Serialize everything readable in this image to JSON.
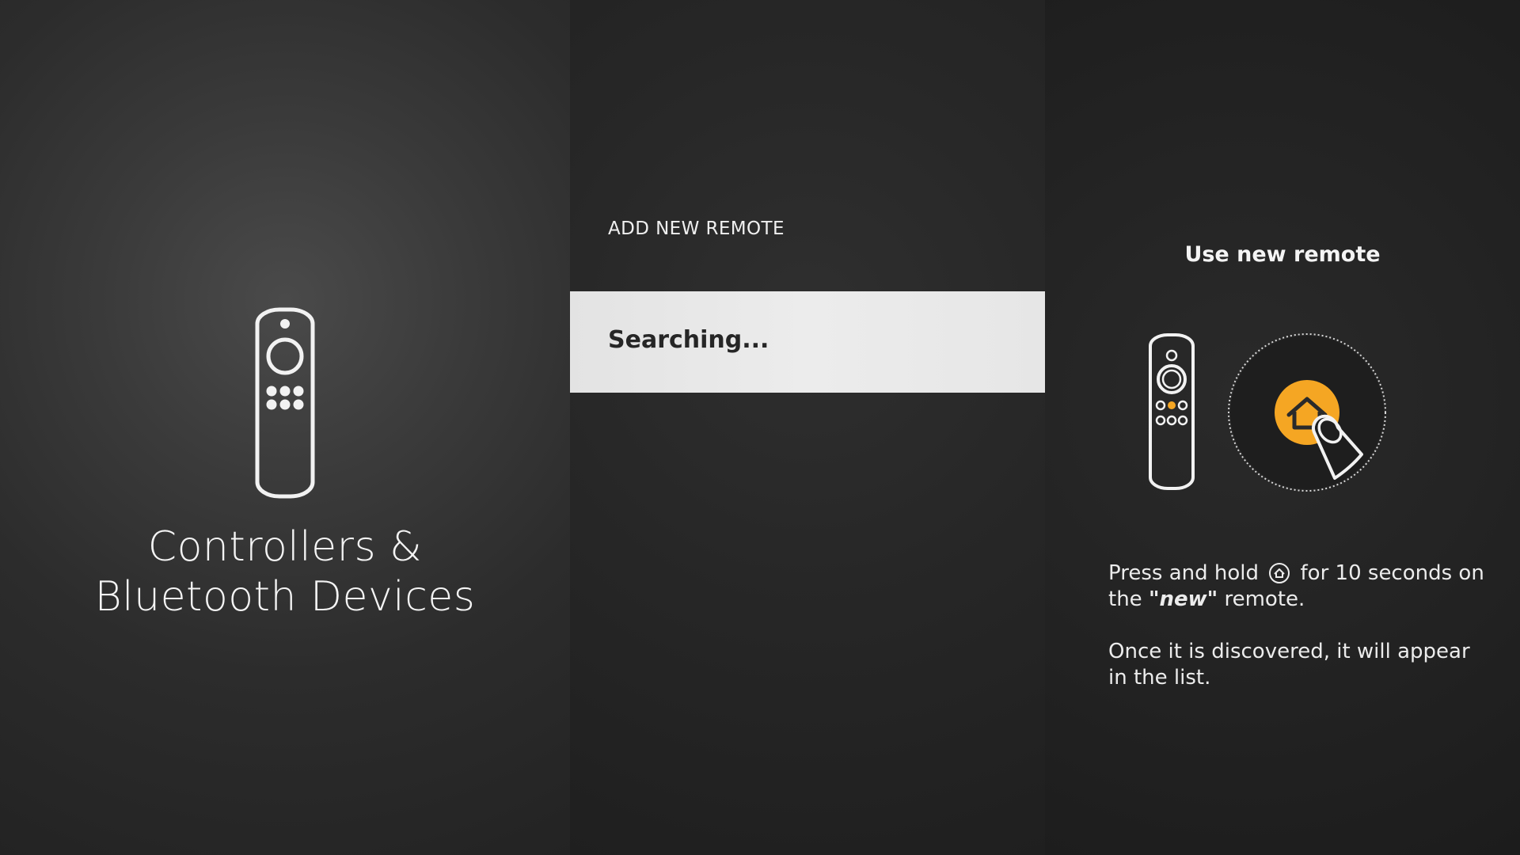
{
  "left": {
    "category_title_line1": "Controllers &",
    "category_title_line2": "Bluetooth Devices",
    "icon": "fire-tv-remote-icon"
  },
  "middle": {
    "section_header": "ADD NEW REMOTE",
    "status": "Searching..."
  },
  "right": {
    "title": "Use new remote",
    "instruction_part1": "Press and hold",
    "instruction_part2": "for 10 seconds on the",
    "instruction_emph": "\"new\"",
    "instruction_part3": "remote.",
    "instruction_para2": "Once it is discovered, it will appear in the list.",
    "icons": [
      "fire-tv-remote-icon",
      "home-button-icon",
      "finger-press-icon"
    ]
  },
  "colors": {
    "accent_orange": "#f5a623",
    "highlight_row": "#e8e8e8",
    "text_light": "#f2f2f2",
    "text_dark": "#262626"
  }
}
